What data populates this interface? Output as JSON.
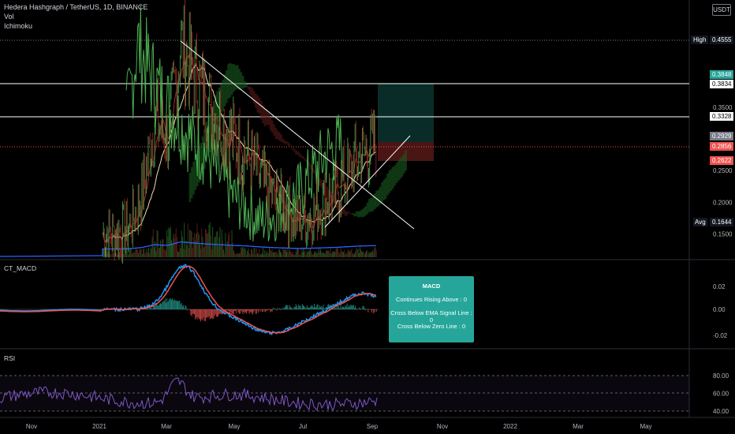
{
  "header": {
    "symbol": "Hedera Hashgraph / TetherUS, 1D, BINANCE",
    "vol": "Vol",
    "ichimoku": "Ichimoku"
  },
  "currency_button": "USDT",
  "price_tags": {
    "high": {
      "label": "High",
      "value": "0.4555",
      "bg": "#131722",
      "fg": "#ffffff"
    },
    "tp1": {
      "value": "0.3848",
      "bg": "#26a69a",
      "fg": "#ffffff"
    },
    "line1": {
      "value": "0.3834",
      "bg": "#ffffff",
      "fg": "#000000"
    },
    "line2": {
      "value": "0.3328",
      "bg": "#ffffff",
      "fg": "#000000"
    },
    "current": {
      "value": "0.2929",
      "bg": "#787b86",
      "fg": "#ffffff"
    },
    "entry": {
      "value": "0.2856",
      "bg": "#ef5350",
      "fg": "#ffffff"
    },
    "stop": {
      "value": "0.2622",
      "bg": "#ef5350",
      "fg": "#ffffff"
    },
    "avg": {
      "label": "Avg",
      "value": "0.1644",
      "bg": "#131722",
      "fg": "#ffffff"
    }
  },
  "macd_box": {
    "title": "MACD",
    "line1": "Continues Rising Above : 0",
    "line2": "Cross Below EMA Signal Line : 0",
    "line3": "Cross Below Zero Line : 0"
  },
  "panes": {
    "macd": "CT_MACD",
    "rsi": "RSI"
  },
  "colors": {
    "candle_up": "#26a69a",
    "candle_down": "#ef5350",
    "price_green": "#4caf50",
    "price_red": "#a52a2a",
    "kijun": "#f5deb3",
    "macd_line": "#2196f3",
    "signal_line": "#ef5350",
    "rsi_line": "#7e57c2",
    "vol_ma": "#2962ff"
  },
  "chart_data": [
    {
      "type": "line",
      "title": "Hedera Hashgraph / TetherUS, 1D, BINANCE",
      "x_ticks": [
        "Nov",
        "2021",
        "Mar",
        "May",
        "Jul",
        "Sep",
        "Nov",
        "2022",
        "Mar",
        "May"
      ],
      "y_ticks": [
        0.35,
        0.25,
        0.2,
        0.15
      ],
      "y_tick_labels": [
        "0.3500",
        "0.2500",
        "0.2000",
        "0.1500"
      ],
      "ylim": [
        0.135,
        0.47
      ],
      "series": [
        {
          "values": [
            0.15,
            0.15,
            0.16,
            0.21,
            0.33,
            0.3,
            0.45,
            0.4,
            0.36,
            0.33,
            0.3,
            0.28,
            0.24,
            0.21,
            0.19,
            0.17,
            0.18,
            0.2,
            0.22,
            0.25,
            0.28,
            0.29
          ]
        }
      ],
      "horizontal_lines": [
        0.4555,
        0.3834,
        0.3328,
        0.2856
      ]
    },
    {
      "type": "bar",
      "title": "CT_MACD",
      "y_ticks": [
        0.02,
        0.0,
        -0.02
      ],
      "y_tick_labels": [
        "0.02",
        "0.00",
        "-0.02"
      ]
    },
    {
      "type": "line",
      "title": "RSI",
      "y_ticks": [
        80,
        60,
        40
      ],
      "y_tick_labels": [
        "80.00",
        "60.00",
        "40.00"
      ],
      "ylim": [
        30,
        90
      ]
    }
  ]
}
